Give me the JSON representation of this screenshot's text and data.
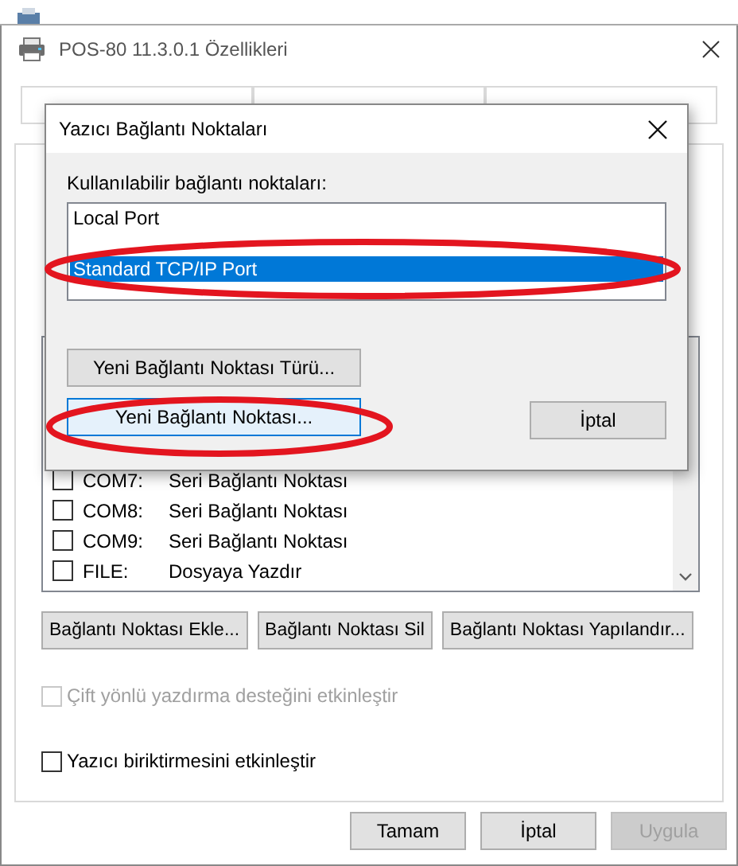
{
  "window": {
    "title": "POS-80 11.3.0.1 Özellikleri"
  },
  "ports": [
    {
      "port": "COM7:",
      "description": "Seri Bağlantı Noktası",
      "checked": false
    },
    {
      "port": "COM8:",
      "description": "Seri Bağlantı Noktası",
      "checked": false
    },
    {
      "port": "COM9:",
      "description": "Seri Bağlantı Noktası",
      "checked": false
    },
    {
      "port": "FILE:",
      "description": "Dosyaya Yazdır",
      "checked": false
    }
  ],
  "port_buttons": [
    "Bağlantı Noktası Ekle...",
    "Bağlantı Noktası Sil",
    "Bağlantı Noktası Yapılandır..."
  ],
  "options": [
    {
      "label": "Çift yönlü yazdırma desteğini etkinleştir",
      "checked": false,
      "disabled": true
    },
    {
      "label": "Yazıcı biriktirmesini etkinleştir",
      "checked": false,
      "disabled": false
    }
  ],
  "buttons": [
    {
      "label": "Tamam",
      "disabled": false
    },
    {
      "label": "İptal",
      "disabled": false
    },
    {
      "label": "Uygula",
      "disabled": true
    }
  ],
  "dialog": {
    "title": "Yazıcı Bağlantı Noktaları",
    "list_label": "Kullanılabilir bağlantı noktaları:",
    "port_types": [
      {
        "label": "Local Port",
        "selected": false
      },
      {
        "label": "Standard TCP/IP Port",
        "selected": true
      }
    ],
    "buttons": [
      {
        "label": "Yeni Bağlantı Noktası Türü...",
        "focused": false
      },
      {
        "label": "Yeni Bağlantı Noktası...",
        "focused": true
      },
      {
        "label": "İptal",
        "focused": false
      }
    ]
  }
}
